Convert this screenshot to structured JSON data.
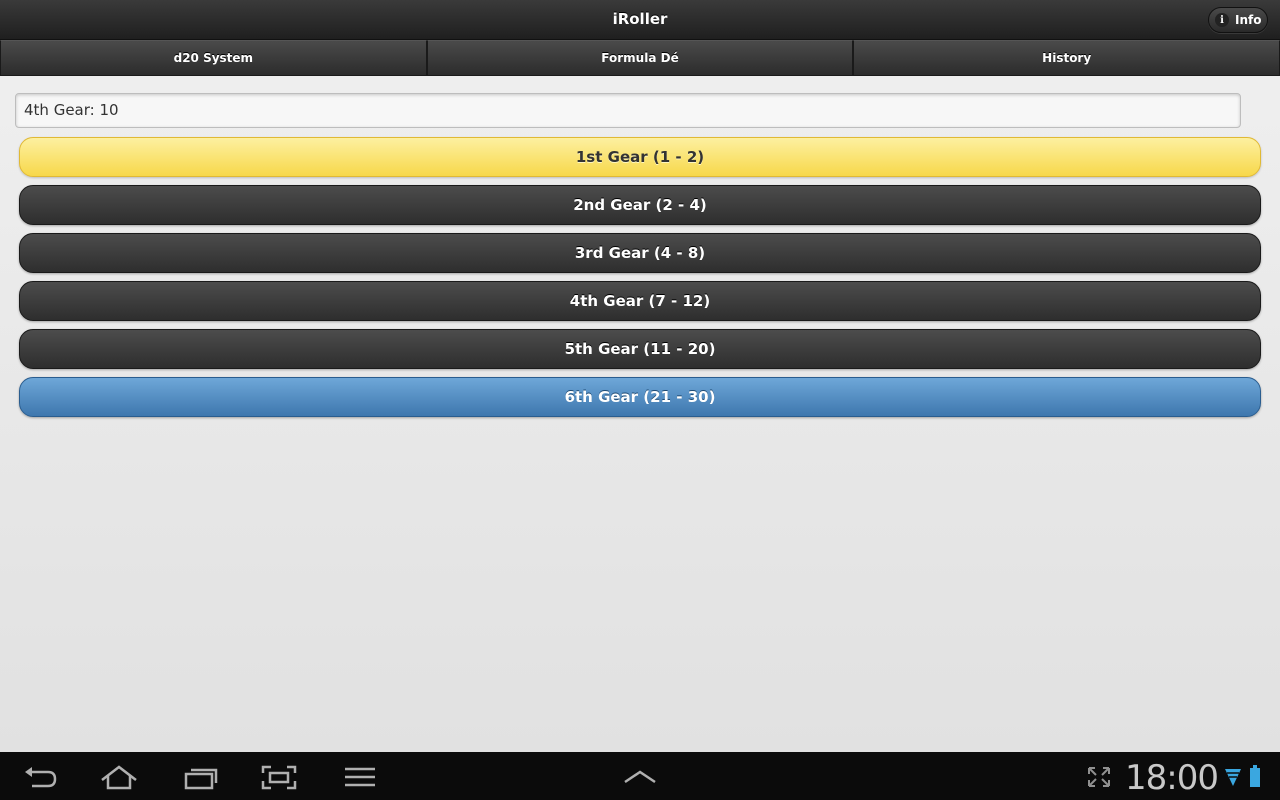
{
  "app": {
    "title": "iRoller",
    "info_label": "Info",
    "info_glyph": "i"
  },
  "tabs": [
    {
      "label": "d20 System"
    },
    {
      "label": "Formula Dé"
    },
    {
      "label": "History"
    }
  ],
  "result": {
    "value": "4th Gear: 10"
  },
  "gears": [
    {
      "label": "1st Gear (1 - 2)",
      "style": "yellow"
    },
    {
      "label": "2nd Gear (2 - 4)",
      "style": "dark"
    },
    {
      "label": "3rd Gear (4 - 8)",
      "style": "dark"
    },
    {
      "label": "4th Gear (7 - 12)",
      "style": "dark"
    },
    {
      "label": "5th Gear (11 - 20)",
      "style": "dark"
    },
    {
      "label": "6th Gear (21 - 30)",
      "style": "blue"
    }
  ],
  "system_bar": {
    "time": "18:00",
    "icons": [
      "back-icon",
      "home-icon",
      "recent-apps-icon",
      "screenshot-icon",
      "menu-icon",
      "up-arrow-icon",
      "expand-icon",
      "wifi-icon",
      "battery-icon"
    ]
  },
  "colors": {
    "accent_blue": "#3e77ae",
    "accent_yellow": "#f7d84a",
    "bar_dark": "#2e2e2e"
  }
}
